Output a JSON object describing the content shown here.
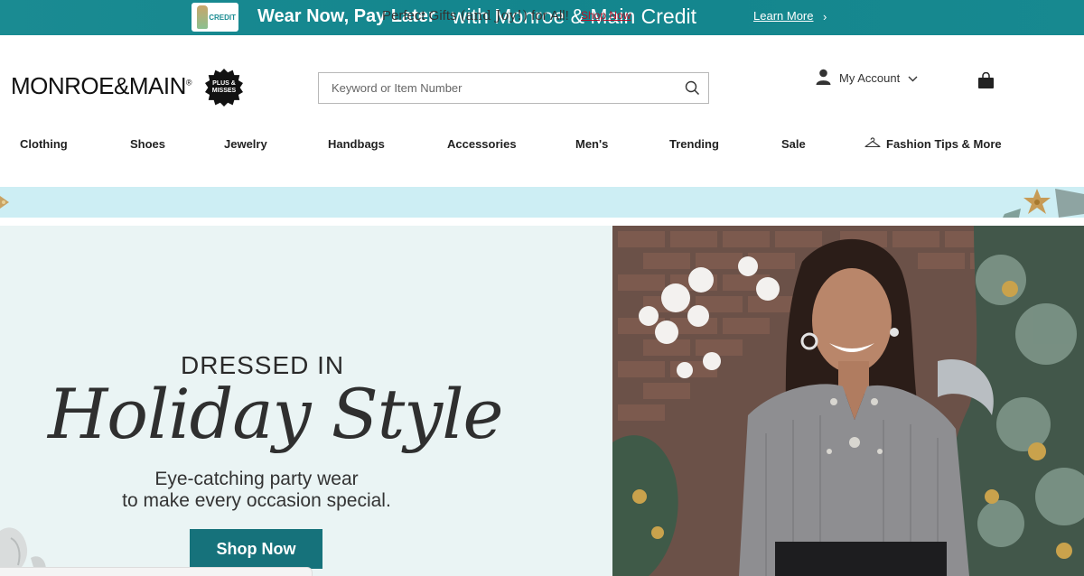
{
  "promo_bar": {
    "card_label": "CREDIT",
    "headline_bold": "Wear Now, Pay Later",
    "headline_light": "with Monroe & Main Credit",
    "link_label": "Learn More",
    "chevron_glyph": "›",
    "background_color": "#178990"
  },
  "header": {
    "logo_text_a": "MONROE",
    "logo_amp": "&",
    "logo_text_b": "MAIN",
    "logo_reg": "®",
    "badge_text": "PLUS & MISSES",
    "search": {
      "placeholder": "Keyword or Item Number",
      "value": ""
    },
    "account_label": "My Account",
    "icons": [
      "search-icon",
      "user-icon",
      "chevron-down-icon",
      "shopping-bag-icon"
    ]
  },
  "nav": {
    "items": [
      "Clothing",
      "Shoes",
      "Jewelry",
      "Handbags",
      "Accessories",
      "Men's",
      "Trending",
      "Sale"
    ],
    "tips_label": "Fashion Tips & More",
    "tips_icon": "hanger-icon"
  },
  "gifts_strip": {
    "text_a": "Perfect Gifts",
    "text_serif": "(and Joy!)",
    "text_b": "for All!",
    "link_label": "Shop Now",
    "background_color": "#cdeef4",
    "link_color": "#b3122a"
  },
  "hero": {
    "kicker": "DRESSED IN",
    "title": "Holiday Style",
    "subtitle_line1": "Eye-catching party wear",
    "subtitle_line2": "to make every occasion special.",
    "button_label": "Shop Now",
    "button_color": "#16727b",
    "background_color": "#eaf4f4"
  }
}
